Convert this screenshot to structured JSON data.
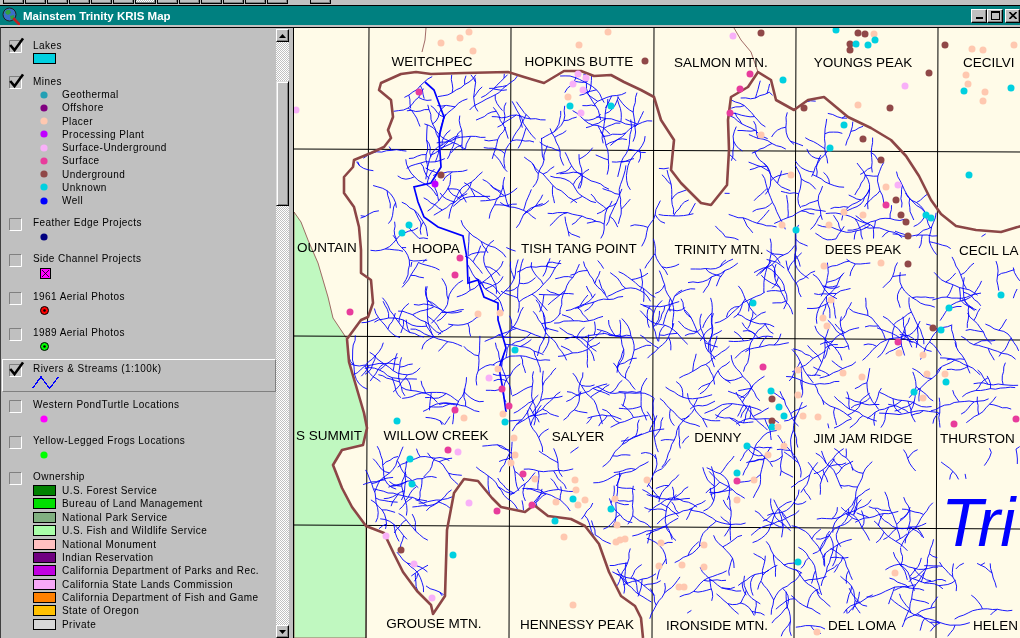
{
  "toolbar": {
    "groups": [
      {
        "tools": [
          {
            "selected": false
          },
          {
            "selected": false
          },
          {
            "selected": false
          },
          {
            "selected": false
          },
          {
            "selected": false
          },
          {
            "selected": false
          },
          {
            "selected": true
          },
          {
            "selected": false
          },
          {
            "selected": false
          },
          {
            "selected": false
          },
          {
            "selected": false
          },
          {
            "selected": false
          },
          {
            "selected": false
          }
        ]
      },
      {
        "tools": [
          {
            "selected": false
          }
        ]
      }
    ]
  },
  "window": {
    "title": "Mainstem Trinity KRIS Map"
  },
  "legend": {
    "themes": [
      {
        "kind": "polygon",
        "label": "Lakes",
        "checked": true,
        "selected": false,
        "color": "#00d0e0"
      },
      {
        "kind": "point-classes",
        "label": "Mines",
        "checked": true,
        "selected": false,
        "classes": [
          {
            "label": "Geothermal",
            "color": "#24a0b4"
          },
          {
            "label": "Offshore",
            "color": "#800080"
          },
          {
            "label": "Placer",
            "color": "#ffc8b0"
          },
          {
            "label": "Processing Plant",
            "color": "#c000ff"
          },
          {
            "label": "Surface-Underground",
            "color": "#f8b0f8"
          },
          {
            "label": "Surface",
            "color": "#e83c9c"
          },
          {
            "label": "Underground",
            "color": "#904848"
          },
          {
            "label": "Unknown",
            "color": "#00d0e0"
          },
          {
            "label": "Well",
            "color": "#0000ff"
          }
        ]
      },
      {
        "kind": "point",
        "label": "Feather Edge Projects",
        "checked": false,
        "selected": false,
        "color": "#000080"
      },
      {
        "kind": "square-cross",
        "label": "Side Channel Projects",
        "checked": false,
        "selected": false,
        "color": "#ff00ff"
      },
      {
        "kind": "ringed-point",
        "label": "1961 Aerial Photos",
        "checked": false,
        "selected": false,
        "color": "#ff0000"
      },
      {
        "kind": "ringed-point",
        "label": "1989 Aerial Photos",
        "checked": false,
        "selected": false,
        "color": "#00ff00"
      },
      {
        "kind": "line",
        "label": "Rivers & Streams (1:100k)",
        "checked": true,
        "selected": true,
        "color": "#0000ff"
      },
      {
        "kind": "point",
        "label": "Western PondTurtle Locations",
        "checked": false,
        "selected": false,
        "color": "#ff00ff"
      },
      {
        "kind": "point",
        "label": "Yellow-Legged Frogs Locations",
        "checked": false,
        "selected": false,
        "color": "#00ff00"
      },
      {
        "kind": "polygon-classes",
        "label": "Ownership",
        "checked": false,
        "selected": false,
        "classes": [
          {
            "label": "U.S. Forest Service",
            "color": "#008000"
          },
          {
            "label": "Bureau of Land Management",
            "color": "#00e000"
          },
          {
            "label": "National Park Service",
            "color": "#80b080"
          },
          {
            "label": "U.S. Fish and Wildlife Service",
            "color": "#a8ffa8"
          },
          {
            "label": "National Monument",
            "color": "#ffc0c0"
          },
          {
            "label": "Indian Reservation",
            "color": "#700080"
          },
          {
            "label": "California Department of Parks and Rec.",
            "color": "#c000e0"
          },
          {
            "label": "California State Lands Commission",
            "color": "#f8a8f8"
          },
          {
            "label": "California Department of Fish and Game",
            "color": "#ff8000"
          },
          {
            "label": "State of Oregon",
            "color": "#ffc000"
          },
          {
            "label": "Private",
            "color": "#d8d8d8"
          }
        ]
      }
    ]
  },
  "map": {
    "place_names": [
      "WEITCHPEC",
      "HOPKINS BUTTE",
      "SALMON MTN.",
      "YOUNGS PEAK",
      "CECILVI",
      "OUNTAIN",
      "HOOPA",
      "TISH TANG POINT",
      "TRINITY MTN.",
      "DEES PEAK",
      "CECIL LA",
      "S SUMMIT",
      "WILLOW CREEK",
      "SALYER",
      "DENNY",
      "JIM JAM RIDGE",
      "THURSTON",
      "GROUSE MTN.",
      "HENNESSY PEAK",
      "IRONSIDE MTN.",
      "DEL LOMA",
      "HELEN"
    ],
    "river_label": "Tri"
  }
}
